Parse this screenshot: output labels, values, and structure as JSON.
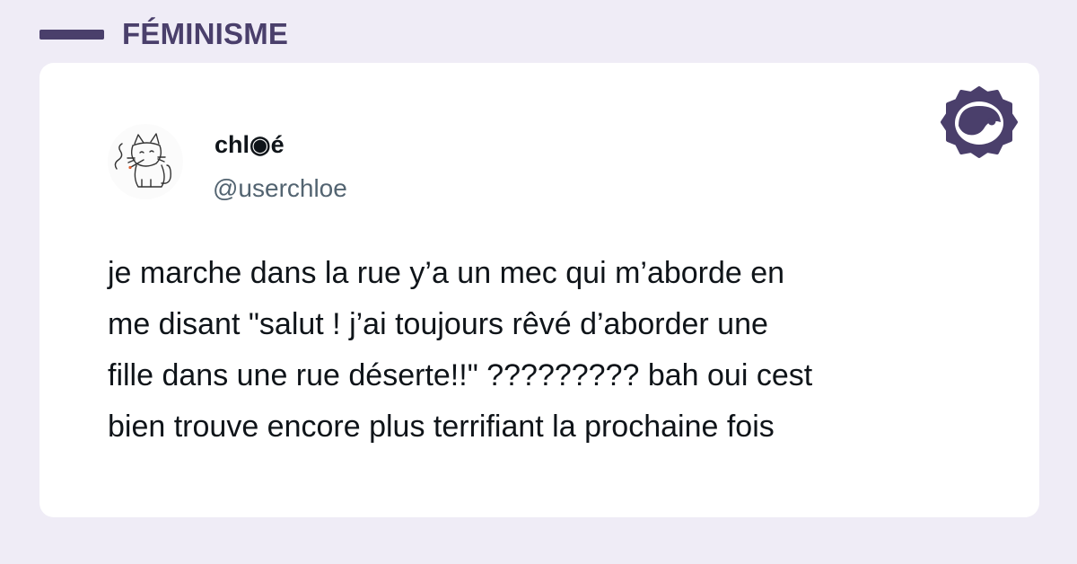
{
  "category": {
    "label": "FÉMINISME"
  },
  "tweet": {
    "display_name": "chl◉é",
    "handle": "@userchloe",
    "text": "je marche dans la rue y’a un mec qui m’aborde en\nme disant \"salut ! j’ai toujours rêvé d’aborder une\nfille dans une rue déserte!!\" ????????? bah oui cest\nbien trouve encore plus terrifiant la prochaine fois"
  },
  "icons": {
    "category_marker": "bar-marker",
    "brand": "madmoizelle-logo-icon",
    "avatar": "cat-drawing-avatar"
  },
  "colors": {
    "background": "#efecf6",
    "accent": "#4a3f6b",
    "text": "#0f1419",
    "muted": "#536471"
  }
}
